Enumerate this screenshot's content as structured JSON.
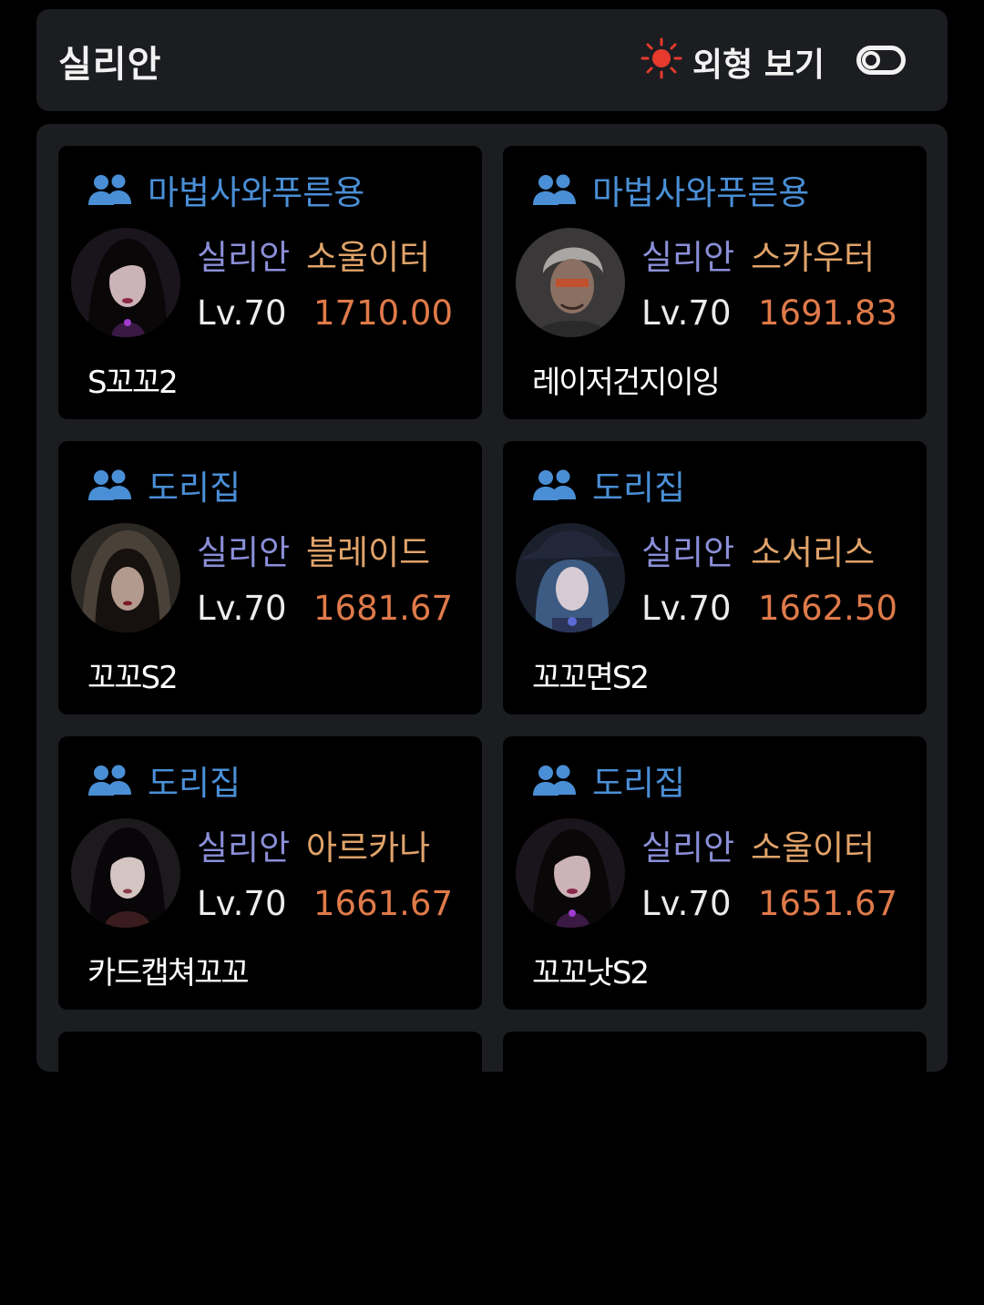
{
  "header": {
    "title": "실리안",
    "view_toggle_label": "외형 보기",
    "sun_icon": "sun-icon",
    "sun_color": "#e63a2e",
    "toggle_state": "off"
  },
  "colors": {
    "guild": "#4a8fd6",
    "server": "#8b8fd8",
    "class": "#e0a36a",
    "item_level": "#df7a4a"
  },
  "characters": [
    {
      "guild": "마법사와푸른용",
      "server": "실리안",
      "class": "소울이터",
      "level": "Lv.70",
      "item_level": "1710.00",
      "name": "S꼬꼬2"
    },
    {
      "guild": "마법사와푸른용",
      "server": "실리안",
      "class": "스카우터",
      "level": "Lv.70",
      "item_level": "1691.83",
      "name": "레이저건지이잉"
    },
    {
      "guild": "도리집",
      "server": "실리안",
      "class": "블레이드",
      "level": "Lv.70",
      "item_level": "1681.67",
      "name": "꼬꼬S2"
    },
    {
      "guild": "도리집",
      "server": "실리안",
      "class": "소서리스",
      "level": "Lv.70",
      "item_level": "1662.50",
      "name": "꼬꼬면S2"
    },
    {
      "guild": "도리집",
      "server": "실리안",
      "class": "아르카나",
      "level": "Lv.70",
      "item_level": "1661.67",
      "name": "카드캡쳐꼬꼬"
    },
    {
      "guild": "도리집",
      "server": "실리안",
      "class": "소울이터",
      "level": "Lv.70",
      "item_level": "1651.67",
      "name": "꼬꼬낫S2"
    }
  ]
}
